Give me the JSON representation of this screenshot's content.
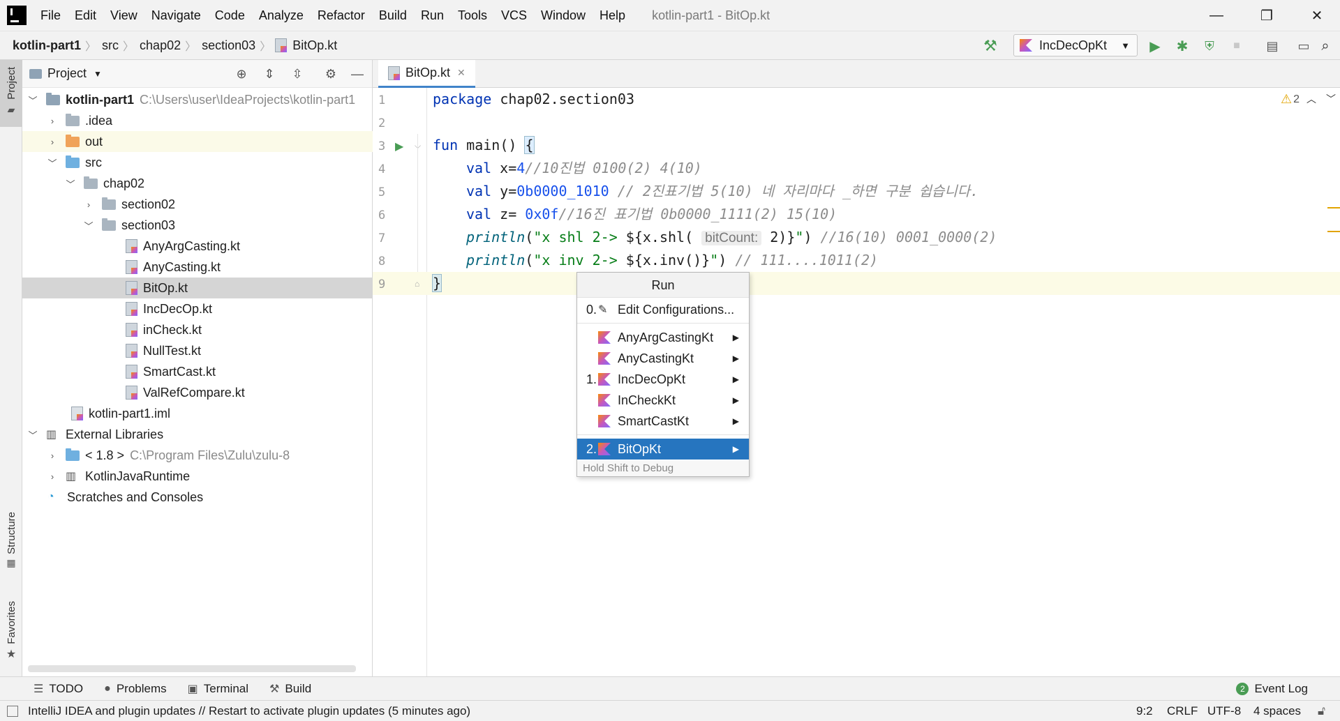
{
  "window": {
    "menu": [
      "File",
      "Edit",
      "View",
      "Navigate",
      "Code",
      "Analyze",
      "Refactor",
      "Build",
      "Run",
      "Tools",
      "VCS",
      "Window",
      "Help"
    ],
    "title": "kotlin-part1 - BitOp.kt",
    "controls": {
      "minimize": "—",
      "restore": "❐",
      "close": "✕"
    }
  },
  "navbar": {
    "breadcrumbs": [
      "kotlin-part1",
      "src",
      "chap02",
      "section03",
      "BitOp.kt"
    ],
    "run_config": "IncDecOpKt"
  },
  "left_strip": {
    "project": "Project",
    "structure": "Structure",
    "favorites": "Favorites"
  },
  "project_panel": {
    "title": "Project",
    "tree": [
      {
        "label": "kotlin-part1",
        "path": "C:\\Users\\user\\IdeaProjects\\kotlin-part1"
      },
      {
        "label": ".idea"
      },
      {
        "label": "out"
      },
      {
        "label": "src"
      },
      {
        "label": "chap02"
      },
      {
        "label": "section02"
      },
      {
        "label": "section03"
      },
      {
        "label": "AnyArgCasting.kt"
      },
      {
        "label": "AnyCasting.kt"
      },
      {
        "label": "BitOp.kt"
      },
      {
        "label": "IncDecOp.kt"
      },
      {
        "label": "inCheck.kt"
      },
      {
        "label": "NullTest.kt"
      },
      {
        "label": "SmartCast.kt"
      },
      {
        "label": "ValRefCompare.kt"
      },
      {
        "label": "kotlin-part1.iml"
      },
      {
        "label": "External Libraries"
      },
      {
        "label": "< 1.8 >",
        "path": "C:\\Program Files\\Zulu\\zulu-8"
      },
      {
        "label": "KotlinJavaRuntime"
      },
      {
        "label": "Scratches and Consoles"
      }
    ]
  },
  "editor": {
    "tab": "BitOp.kt",
    "warnings": "2",
    "line_numbers": [
      "1",
      "2",
      "3",
      "4",
      "5",
      "6",
      "7",
      "8",
      "9"
    ],
    "code": {
      "l1_kw": "package",
      "l1_rest": " chap02.section03",
      "l3_kw": "fun",
      "l3_rest": " main() ",
      "l3_brace": "{",
      "l4_kw": "val",
      "l4_a": " x=",
      "l4_num": "4",
      "l4_cmt": "//10진법 0100(2) 4(10)",
      "l5_kw": "val",
      "l5_a": " y=",
      "l5_num": "0b0000_1010",
      "l5_cmt": " // 2진표기법 5(10) 네 자리마다 _하면 구분 쉽습니다.",
      "l6_kw": "val",
      "l6_a": " z= ",
      "l6_num": "0x0f",
      "l6_cmt": "//16진 표기법 0b0000_1111(2) 15(10)",
      "l7_fn": "println",
      "l7_a": "(",
      "l7_str": "\"x shl 2-> ",
      "l7_b": "${x.shl( ",
      "l7_hint": "bitCount:",
      "l7_c": " 2)}",
      "l7_str2": "\"",
      "l7_d": ") ",
      "l7_cmt": "//16(10) 0001_0000(2)",
      "l8_fn": "println",
      "l8_a": "(",
      "l8_str": "\"x inv 2-> ",
      "l8_b": "${x.inv()}",
      "l8_str2": "\"",
      "l8_d": ") ",
      "l8_cmt": "// 111....1011(2)",
      "l9_brace": "}"
    }
  },
  "run_popup": {
    "title": "Run",
    "edit_num": "0.",
    "edit_label": "Edit Configurations...",
    "items": [
      {
        "num": "",
        "label": "AnyArgCastingKt"
      },
      {
        "num": "",
        "label": "AnyCastingKt"
      },
      {
        "num": "1.",
        "label": "IncDecOpKt"
      },
      {
        "num": "",
        "label": "InCheckKt"
      },
      {
        "num": "",
        "label": "SmartCastKt"
      }
    ],
    "selected_num": "2.",
    "selected_label": "BitOpKt",
    "hint": "Hold Shift to Debug"
  },
  "bottom_tools": {
    "todo": "TODO",
    "problems": "Problems",
    "terminal": "Terminal",
    "build": "Build",
    "event_log_count": "2",
    "event_log": "Event Log"
  },
  "status": {
    "message": "IntelliJ IDEA and plugin updates // Restart to activate plugin updates (5 minutes ago)",
    "position": "9:2",
    "line_sep": "CRLF",
    "encoding": "UTF-8",
    "indent": "4 spaces"
  },
  "colors": {
    "accent": "#2675bf",
    "run_green": "#499c54",
    "keyword": "#0033b3",
    "string": "#067d17",
    "comment": "#8c8c8c",
    "warning": "#e2a400"
  }
}
